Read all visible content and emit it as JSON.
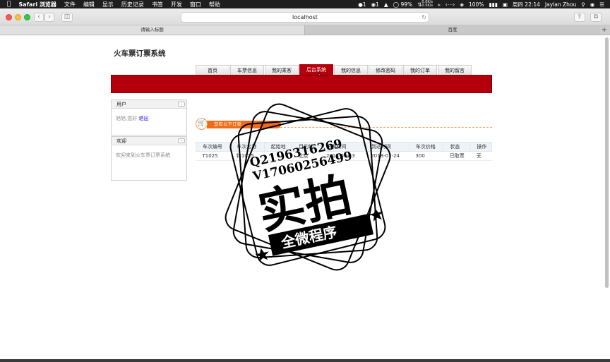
{
  "menubar": {
    "apple": "",
    "items": [
      "Safari 浏览器",
      "文件",
      "编辑",
      "显示",
      "历史记录",
      "书签",
      "开发",
      "窗口",
      "帮助"
    ],
    "status": {
      "qq_count": "1",
      "wechat_count": "1",
      "battery_ring": "99%",
      "net_up": "0.0K/s",
      "net_down": "0.5K/s",
      "battery": "100%",
      "clock": "周四 22:14",
      "user": "Jaylan Zhou"
    }
  },
  "browser": {
    "address": "localhost",
    "tabs": [
      "请输入标题",
      "百度"
    ],
    "new_tab": "+",
    "back": "‹",
    "forward": "›"
  },
  "site": {
    "title": "火车票订票系统",
    "nav": [
      "首页",
      "车票信息",
      "我的乘客",
      "后台系统",
      "我的信息",
      "修改密码",
      "我的订单",
      "我的留言"
    ],
    "active_nav_index": 3
  },
  "sidebar": {
    "user_panel": {
      "title": "用户",
      "greeting": "旭旭,您好",
      "logout": "退出"
    },
    "welcome_panel": {
      "title": "欢迎",
      "text": "欢迎来到火车票订票系统"
    }
  },
  "notice": {
    "text": "您有以下订单"
  },
  "orders": {
    "columns": [
      "车次编号",
      "车次名称",
      "起始地",
      "目的地",
      "出发时间",
      "到达时间",
      "车次价格",
      "状态",
      "操作"
    ],
    "rows": [
      [
        "T1025",
        "特1025",
        "",
        "北京",
        "2018-03-23",
        "2018-03-24",
        "300",
        "已取票",
        "无"
      ]
    ]
  },
  "watermark": {
    "line1": "Q2196316269",
    "line2": "V17060256499",
    "big": "实拍",
    "banner": "全微程序"
  },
  "colors": {
    "accent": "#b4000c",
    "notice": "#ee6c17",
    "link": "#0000cc"
  }
}
